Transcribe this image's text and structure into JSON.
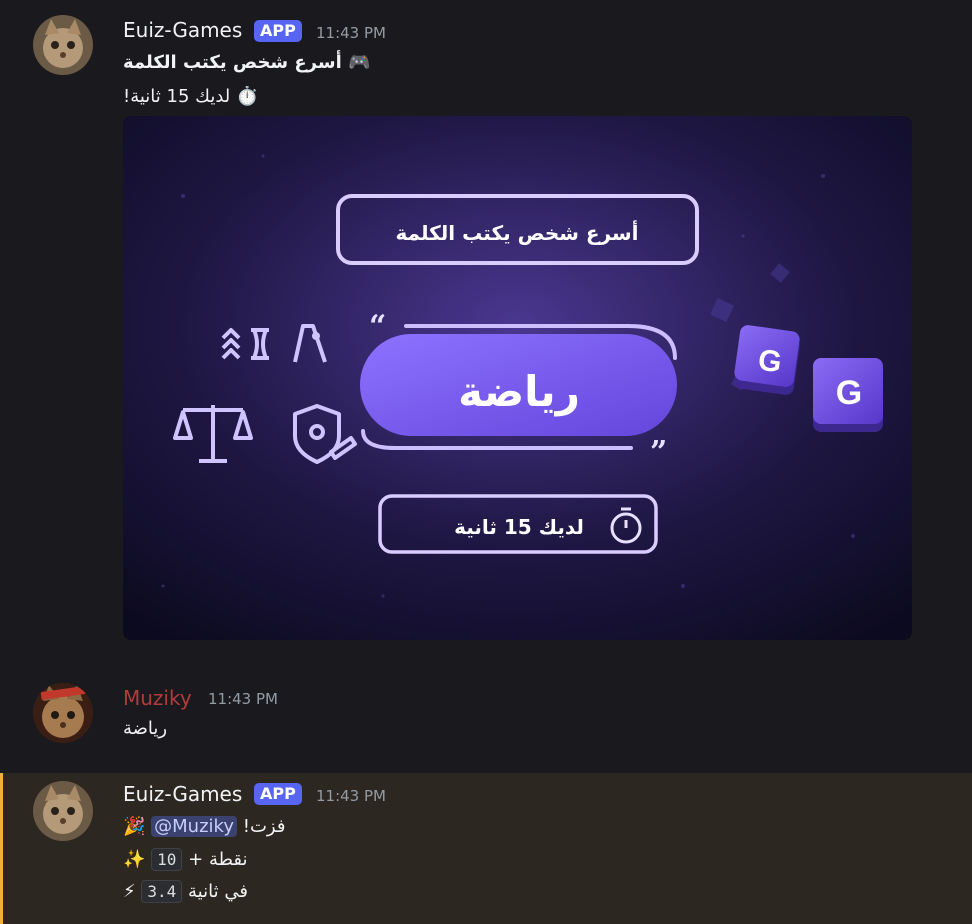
{
  "messages": [
    {
      "username": "Euiz-Games",
      "badge": "APP",
      "time": "11:43 PM",
      "lines": [
        "أسرع شخص يكتب الكلمة 🎮",
        "!لديك 15 ثانية ⏱️"
      ],
      "image": {
        "prompt_box": "أسرع شخص يكتب الكلمة",
        "word": "رياضة",
        "timer_text": "لديك 15 ثانية",
        "key_letter": "G"
      }
    },
    {
      "username": "Muziky",
      "time": "11:43 PM",
      "lines": [
        "رياضة"
      ],
      "name_color": "#b13c3c"
    },
    {
      "username": "Euiz-Games",
      "badge": "APP",
      "time": "11:43 PM",
      "win_prefix": "🎉",
      "mention": "@Muziky",
      "win_suffix": "!فزت",
      "points_prefix": "✨",
      "points_value": "10",
      "points_suffix": "+ نقطة",
      "speed_prefix": "⚡",
      "speed_value": "3.4",
      "speed_suffix": "في ثانية"
    }
  ],
  "colors": {
    "accent": "#5865f2",
    "highlight_bar": "#f0b232",
    "card_purple": "#7b5cf0"
  }
}
